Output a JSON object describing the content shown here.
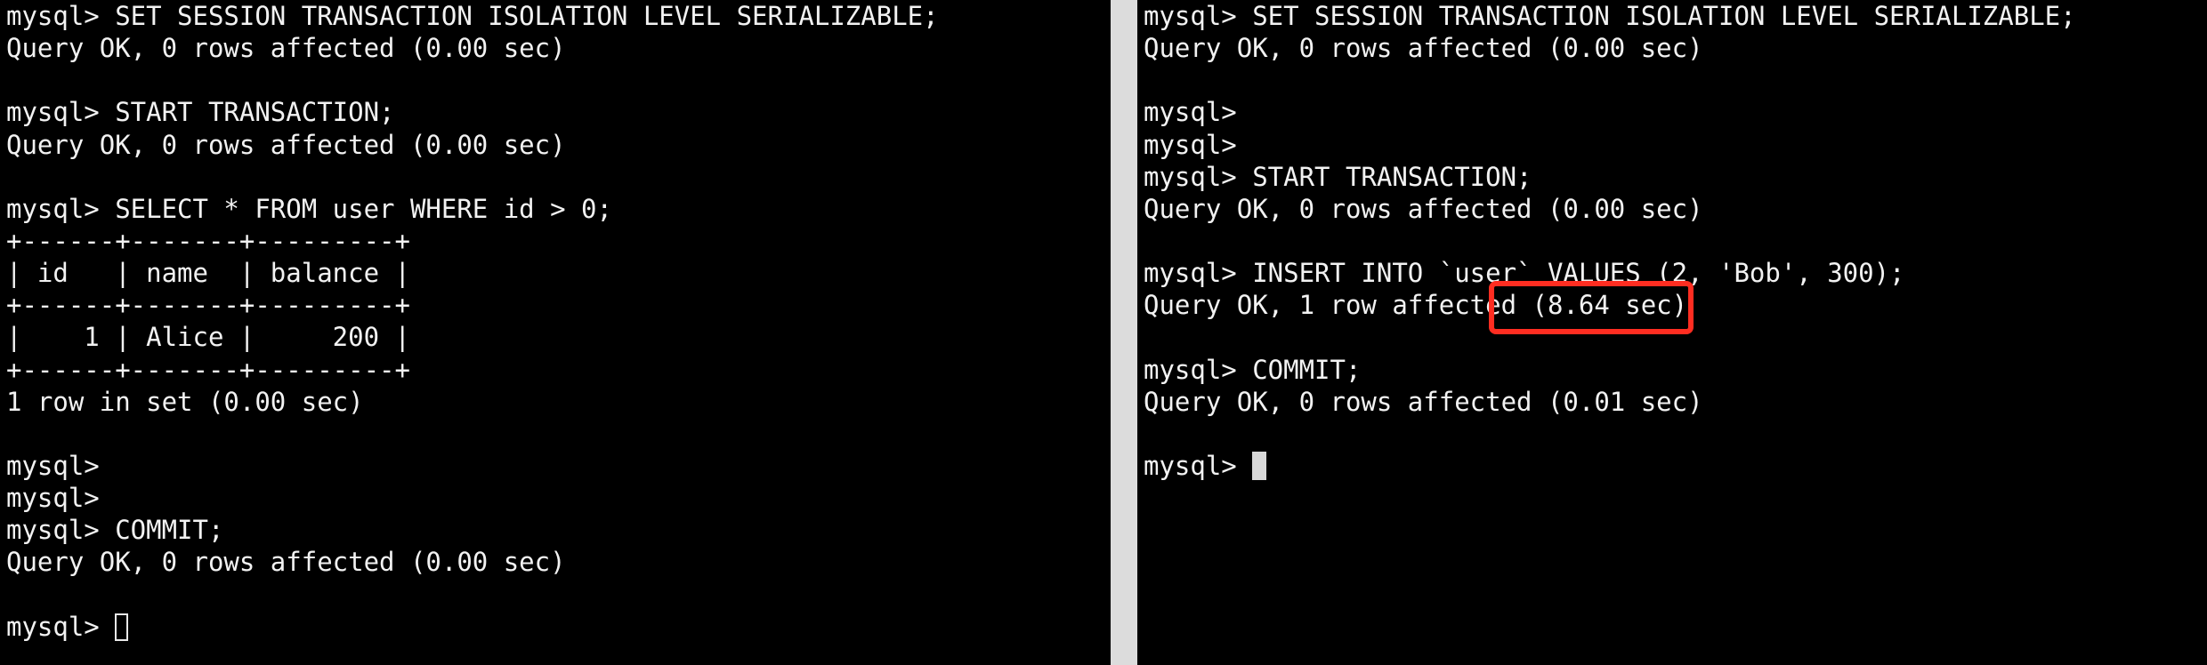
{
  "left_terminal": {
    "lines": [
      "mysql> SET SESSION TRANSACTION ISOLATION LEVEL SERIALIZABLE;",
      "Query OK, 0 rows affected (0.00 sec)",
      "",
      "mysql> START TRANSACTION;",
      "Query OK, 0 rows affected (0.00 sec)",
      "",
      "mysql> SELECT * FROM user WHERE id > 0;",
      "+------+-------+---------+",
      "| id   | name  | balance |",
      "+------+-------+---------+",
      "|    1 | Alice |     200 |",
      "+------+-------+---------+",
      "1 row in set (0.00 sec)",
      "",
      "mysql>",
      "mysql>",
      "mysql> COMMIT;",
      "Query OK, 0 rows affected (0.00 sec)",
      ""
    ],
    "prompt": "mysql> "
  },
  "right_terminal": {
    "lines": [
      "mysql> SET SESSION TRANSACTION ISOLATION LEVEL SERIALIZABLE;",
      "Query OK, 0 rows affected (0.00 sec)",
      "",
      "mysql>",
      "mysql>",
      "mysql> START TRANSACTION;",
      "Query OK, 0 rows affected (0.00 sec)",
      "",
      "mysql> INSERT INTO `user` VALUES (2, 'Bob', 300);",
      "Query OK, 1 row affected (8.64 sec)",
      "",
      "mysql> COMMIT;",
      "Query OK, 0 rows affected (0.01 sec)",
      ""
    ],
    "prompt": "mysql> "
  },
  "annotation": {
    "color": "#ff2d21"
  }
}
